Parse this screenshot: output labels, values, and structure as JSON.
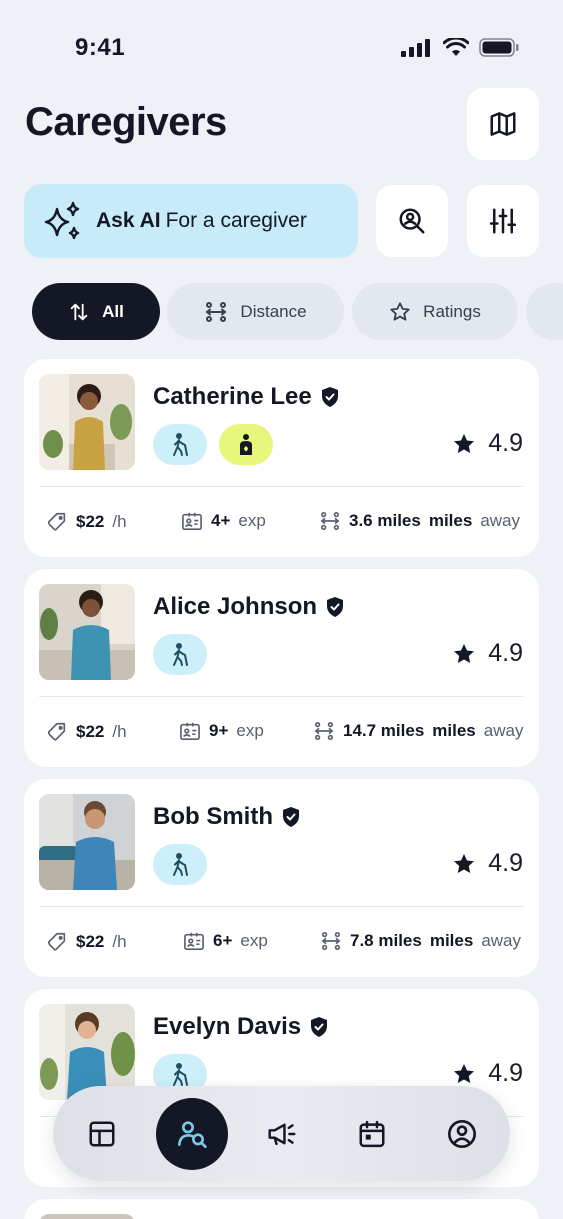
{
  "status_bar": {
    "time": "9:41"
  },
  "header": {
    "title": "Caregivers"
  },
  "ask_ai": {
    "strong": "Ask AI",
    "text": "For a caregiver"
  },
  "filters": [
    {
      "label": "All"
    },
    {
      "label": "Distance"
    },
    {
      "label": "Ratings"
    }
  ],
  "caregivers": [
    {
      "name": "Catherine Lee",
      "rating": "4.9",
      "price": "$22",
      "price_unit": "/h",
      "exp": "4+",
      "exp_unit": "exp",
      "distance": "3.6 miles",
      "distance_unit": "miles",
      "distance_suffix": "away"
    },
    {
      "name": "Alice Johnson",
      "rating": "4.9",
      "price": "$22",
      "price_unit": "/h",
      "exp": "9+",
      "exp_unit": "exp",
      "distance": "14.7 miles",
      "distance_unit": "miles",
      "distance_suffix": "away"
    },
    {
      "name": "Bob Smith",
      "rating": "4.9",
      "price": "$22",
      "price_unit": "/h",
      "exp": "6+",
      "exp_unit": "exp",
      "distance": "7.8 miles",
      "distance_unit": "miles",
      "distance_suffix": "away"
    },
    {
      "name": "Evelyn Davis",
      "rating": "4.9"
    }
  ],
  "tab_bar": {
    "items": [
      {
        "icon": "dashboard-icon"
      },
      {
        "icon": "search-user-icon"
      },
      {
        "icon": "megaphone-icon"
      },
      {
        "icon": "calendar-icon"
      },
      {
        "icon": "profile-icon"
      }
    ]
  },
  "colors": {
    "accent_dark": "#141726",
    "ai_bg": "#c8ebf9",
    "mobility_badge": "#cdeffa",
    "care_badge": "#e6f77b",
    "background": "#eef1f6"
  }
}
